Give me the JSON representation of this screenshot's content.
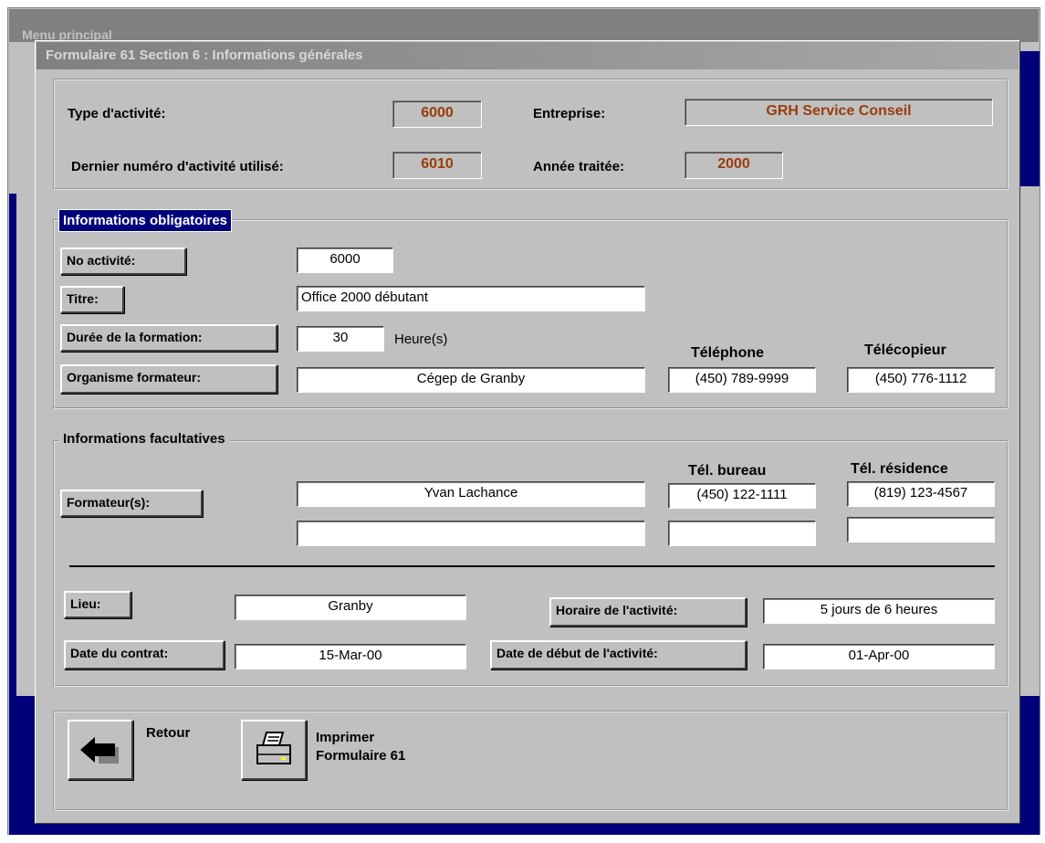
{
  "background_window": {
    "title": "Menu principal"
  },
  "dialog": {
    "title": "Formulaire 61  Section 6 : Informations générales"
  },
  "header": {
    "type_activite_label": "Type d'activité:",
    "type_activite_value": "6000",
    "entreprise_label": "Entreprise:",
    "entreprise_value": "GRH Service Conseil",
    "dernier_numero_label": "Dernier numéro d'activité utilisé:",
    "dernier_numero_value": "6010",
    "annee_label": "Année traitée:",
    "annee_value": "2000"
  },
  "obligatoires": {
    "legend": "Informations obligatoires",
    "no_activite_button": "No activité:",
    "no_activite_value": "6000",
    "titre_button": "Titre:",
    "titre_value": "Office 2000 débutant",
    "duree_button": "Durée de la formation:",
    "duree_value": "30",
    "duree_unit": "Heure(s)",
    "telephone_header": "Téléphone",
    "telecopieur_header": "Télécopieur",
    "organisme_button": "Organisme formateur:",
    "organisme_value": "Cégep de Granby",
    "telephone_value": "(450) 789-9999",
    "telecopieur_value": "(450) 776-1112"
  },
  "facultatives": {
    "legend": "Informations facultatives",
    "tel_bureau_header": "Tél. bureau",
    "tel_residence_header": "Tél. résidence",
    "formateurs_button": "Formateur(s):",
    "formateur1_value": "Yvan Lachance",
    "formateur1_tel_bureau": "(450) 122-1111",
    "formateur1_tel_residence": "(819) 123-4567",
    "formateur2_value": "",
    "formateur2_tel_bureau": "",
    "formateur2_tel_residence": "",
    "lieu_button": "Lieu:",
    "lieu_value": "Granby",
    "horaire_button": "Horaire de l'activité:",
    "horaire_value": "5 jours de 6 heures",
    "date_contrat_button": "Date du contrat:",
    "date_contrat_value": "15-Mar-00",
    "date_debut_button": "Date de début de l'activité:",
    "date_debut_value": "01-Apr-00"
  },
  "footer": {
    "retour_label": "Retour",
    "imprimer_label_line1": "Imprimer",
    "imprimer_label_line2": "Formulaire 61",
    "retour_icon": "back-arrow-icon",
    "imprimer_icon": "printer-icon"
  },
  "colors": {
    "window_gray": "#c0c0c0",
    "legend_navy": "#00007a",
    "readonly_text": "#9a3c0a"
  }
}
